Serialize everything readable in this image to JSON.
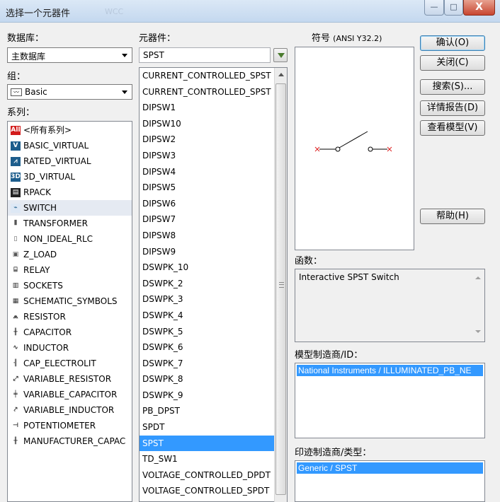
{
  "window": {
    "title": "选择一个元器件",
    "ghost_text": "WCC",
    "minimize": "—",
    "maximize": "□",
    "close": "X"
  },
  "database": {
    "label": "数据库：",
    "value": "主数据库"
  },
  "group": {
    "label": "组：",
    "value": "Basic",
    "icon": "resistor-icon"
  },
  "family": {
    "label": "系列：",
    "items": [
      {
        "label": "<所有系列>",
        "icon": "all-icon"
      },
      {
        "label": "BASIC_VIRTUAL",
        "icon": "basic-virtual-icon"
      },
      {
        "label": "RATED_VIRTUAL",
        "icon": "rated-virtual-icon"
      },
      {
        "label": "3D_VIRTUAL",
        "icon": "3d-virtual-icon"
      },
      {
        "label": "RPACK",
        "icon": "rpack-icon"
      },
      {
        "label": "SWITCH",
        "icon": "switch-icon"
      },
      {
        "label": "TRANSFORMER",
        "icon": "transformer-icon"
      },
      {
        "label": "NON_IDEAL_RLC",
        "icon": "rlc-icon"
      },
      {
        "label": "Z_LOAD",
        "icon": "zload-icon"
      },
      {
        "label": "RELAY",
        "icon": "relay-icon"
      },
      {
        "label": "SOCKETS",
        "icon": "sockets-icon"
      },
      {
        "label": "SCHEMATIC_SYMBOLS",
        "icon": "schematic-icon"
      },
      {
        "label": "RESISTOR",
        "icon": "resistor-icon"
      },
      {
        "label": "CAPACITOR",
        "icon": "capacitor-icon"
      },
      {
        "label": "INDUCTOR",
        "icon": "inductor-icon"
      },
      {
        "label": "CAP_ELECTROLIT",
        "icon": "cap-electrolit-icon"
      },
      {
        "label": "VARIABLE_RESISTOR",
        "icon": "variable-resistor-icon"
      },
      {
        "label": "VARIABLE_CAPACITOR",
        "icon": "variable-capacitor-icon"
      },
      {
        "label": "VARIABLE_INDUCTOR",
        "icon": "variable-inductor-icon"
      },
      {
        "label": "POTENTIOMETER",
        "icon": "potentiometer-icon"
      },
      {
        "label": "MANUFACTURER_CAPAC",
        "icon": "manufacturer-cap-icon"
      }
    ]
  },
  "component": {
    "label": "元器件：",
    "search_value": "SPST",
    "filter_icon": "filter-icon",
    "items": [
      "CURRENT_CONTROLLED_SPST",
      "CURRENT_CONTROLLED_SPST",
      "DIPSW1",
      "DIPSW10",
      "DIPSW2",
      "DIPSW3",
      "DIPSW4",
      "DIPSW5",
      "DIPSW6",
      "DIPSW7",
      "DIPSW8",
      "DIPSW9",
      "DSWPK_10",
      "DSWPK_2",
      "DSWPK_3",
      "DSWPK_4",
      "DSWPK_5",
      "DSWPK_6",
      "DSWPK_7",
      "DSWPK_8",
      "DSWPK_9",
      "PB_DPST",
      "SPDT",
      "SPST",
      "TD_SW1",
      "VOLTAGE_CONTROLLED_DPDT",
      "VOLTAGE_CONTROLLED_SPDT"
    ]
  },
  "symbol": {
    "label": "符号",
    "standard": "(ANSI Y32.2)"
  },
  "function": {
    "label": "函数：",
    "text": "Interactive SPST Switch"
  },
  "model": {
    "label": "模型制造商/ID：",
    "value": "National Instruments / ILLUMINATED_PB_NE"
  },
  "footprint": {
    "label": "印迹制造商/类型：",
    "value": "Generic / SPST"
  },
  "buttons": {
    "ok": "确认(O)",
    "close": "关闭(C)",
    "search": "搜索(S)...",
    "detail": "详情报告(D)",
    "view_model": "查看模型(V)",
    "help": "帮助(H)"
  },
  "colors": {
    "selection": "#3399ff",
    "title_gradient": "#c4d8ef",
    "close_button": "#c84630"
  }
}
